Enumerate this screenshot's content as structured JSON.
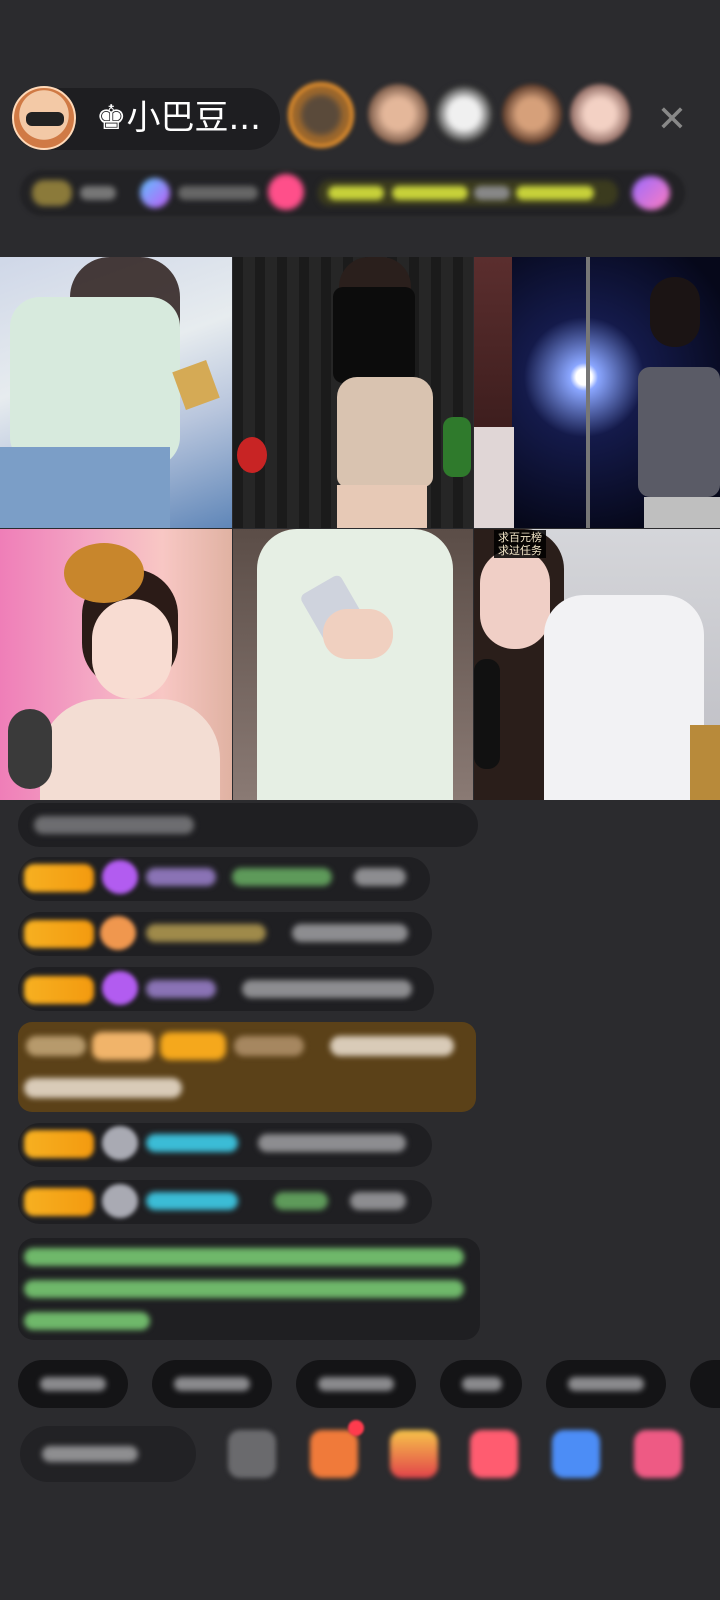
{
  "host": {
    "name": "♚小巴豆..."
  },
  "header": {
    "close_label": "✕"
  },
  "grid": {
    "tile6_label_line1": "求百元榜",
    "tile6_label_line2": "求过任务"
  },
  "colors": {
    "background": "#2b2b2e",
    "badge_gold": "#f5a81c",
    "chat_green": "#7bd36f",
    "chat_cyan": "#3bbcd6",
    "chat_purple": "#b25cf0",
    "highlight_row": "#5b4118"
  },
  "icons": {
    "close": "close-icon",
    "emoji": "emoji-icon",
    "gift": "gift-icon",
    "share": "share-icon",
    "more": "more-icon"
  }
}
